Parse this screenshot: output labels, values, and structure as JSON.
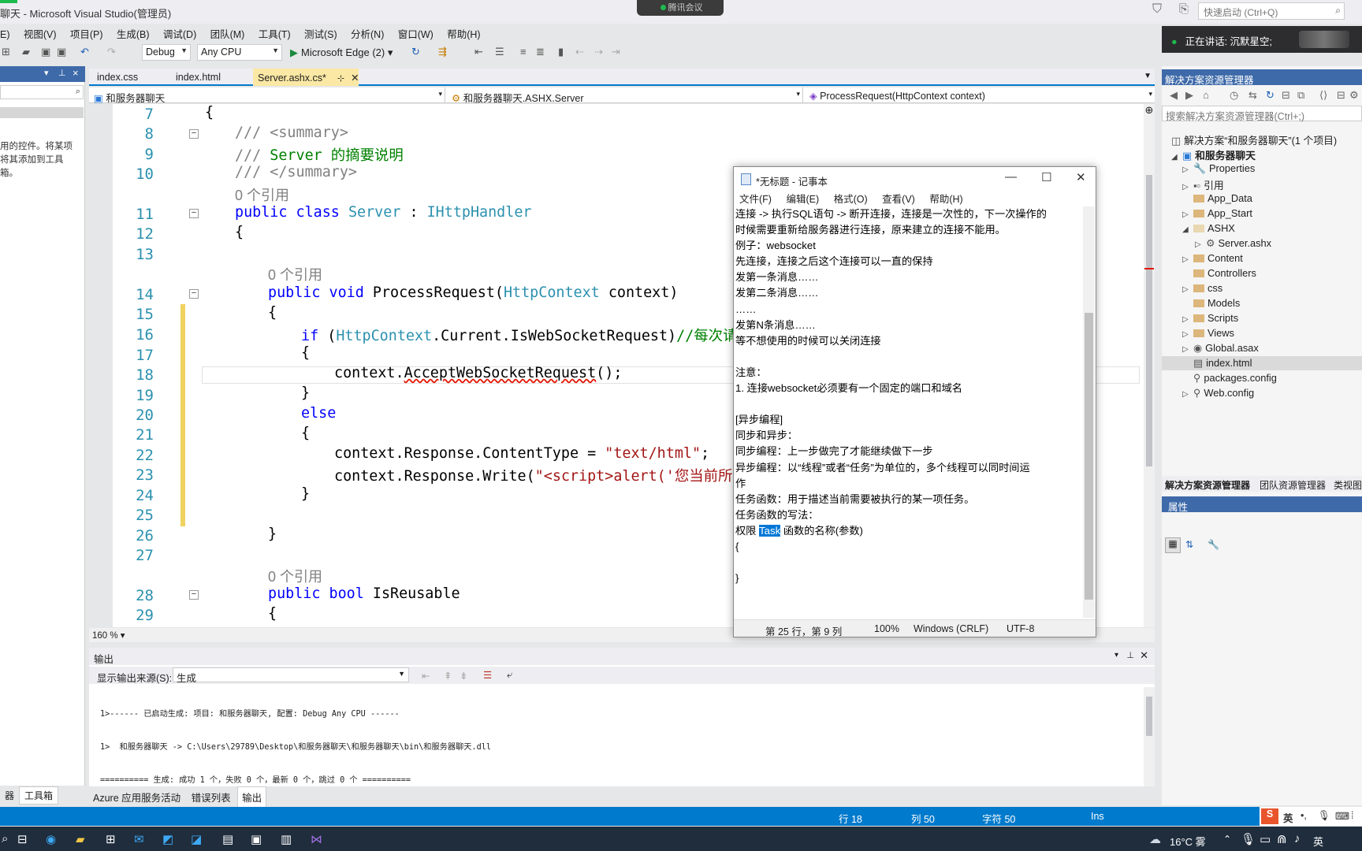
{
  "window": {
    "title": "聊天 - Microsoft Visual Studio(管理员)"
  },
  "meeting": {
    "label": "腾讯会议"
  },
  "quicklaunch": {
    "placeholder": "快速启动 (Ctrl+Q)"
  },
  "speaking": {
    "label": "正在讲话: 沉默星空;"
  },
  "menu": {
    "items": [
      "E)",
      "视图(V)",
      "项目(P)",
      "生成(B)",
      "调试(D)",
      "团队(M)",
      "工具(T)",
      "测试(S)",
      "分析(N)",
      "窗口(W)",
      "帮助(H)"
    ]
  },
  "toolbar": {
    "config": "Debug",
    "platform": "Any CPU",
    "run": "Microsoft Edge (2)"
  },
  "left_panel": {
    "text_lines": [
      "用的控件。将某项",
      "将其添加到工具",
      "箱。"
    ],
    "tabs": [
      "器",
      "工具箱"
    ]
  },
  "editor": {
    "tabs": [
      "index.css",
      "index.html",
      "Server.ashx.cs*"
    ],
    "nav": {
      "project": "和服务器聊天",
      "type": "和服务器聊天.ASHX.Server",
      "member": "ProcessRequest(HttpContext context)"
    },
    "zoom": "160 %",
    "line_numbers": [
      "7",
      "8",
      "9",
      "10",
      "11",
      "12",
      "13",
      "14",
      "15",
      "16",
      "17",
      "18",
      "19",
      "20",
      "21",
      "22",
      "23",
      "24",
      "25",
      "26",
      "27",
      "28",
      "29"
    ],
    "refs": {
      "r1": "0 个引用",
      "r2": "0 个引用",
      "r3": "0 个引用"
    }
  },
  "notepad": {
    "title": "*无标题 - 记事本",
    "menu": [
      "文件(F)",
      "编辑(E)",
      "格式(O)",
      "查看(V)",
      "帮助(H)"
    ],
    "lines_before": "连接 -> 执行SQL语句 -> 断开连接，连接是一次性的，下一次操作的\n时候需要重新给服务器进行连接，原来建立的连接不能用。\n例子：websocket\n先连接，连接之后这个连接可以一直的保持\n发第一条消息……\n发第二条消息……\n……\n发第N条消息……\n等不想使用的时候可以关闭连接\n\n注意：\n1. 连接websocket必须要有一个固定的端口和域名\n\n[异步编程]\n同步和异步：\n同步编程：上一步做完了才能继续做下一步\n异步编程：以“线程”或者“任务”为单位的，多个线程可以同时间运\n作\n任务函数：用于描述当前需要被执行的某一项任务。\n任务函数的写法：\n权限 ",
    "selected": "Task",
    "lines_after": " 函数的名称(参数)\n{\n\n}",
    "status": {
      "pos": "第 25 行，第 9 列",
      "zoom": "100%",
      "eol": "Windows (CRLF)",
      "enc": "UTF-8"
    }
  },
  "solution_explorer": {
    "title": "解决方案资源管理器",
    "search": "搜索解决方案资源管理器(Ctrl+;)",
    "solution": "解决方案“和服务器聊天”(1 个项目)",
    "project": "和服务器聊天",
    "items": [
      "Properties",
      "引用",
      "App_Data",
      "App_Start",
      "ASHX",
      "Server.ashx",
      "Content",
      "Controllers",
      "css",
      "Models",
      "Scripts",
      "Views",
      "Global.asax",
      "index.html",
      "packages.config",
      "Web.config"
    ],
    "tabs": [
      "解决方案资源管理器",
      "团队资源管理器",
      "类视图"
    ],
    "props_title": "属性"
  },
  "output": {
    "title": "输出",
    "source_label": "显示输出来源(S):",
    "source": "生成",
    "lines": [
      "1>------ 已启动生成: 项目: 和服务器聊天, 配置: Debug Any CPU ------",
      "1>  和服务器聊天 -> C:\\Users\\29789\\Desktop\\和服务器聊天\\和服务器聊天\\bin\\和服务器聊天.dll",
      "========== 生成: 成功 1 个，失败 0 个，最新 0 个，跳过 0 个 =========="
    ],
    "tabs": [
      "Azure 应用服务活动",
      "错误列表",
      "输出"
    ]
  },
  "statusbar": {
    "row": "行 18",
    "col": "列 50",
    "char": "字符 50",
    "ins": "Ins"
  },
  "taskbar": {
    "weather": "16°C 雾",
    "ime": "英"
  }
}
